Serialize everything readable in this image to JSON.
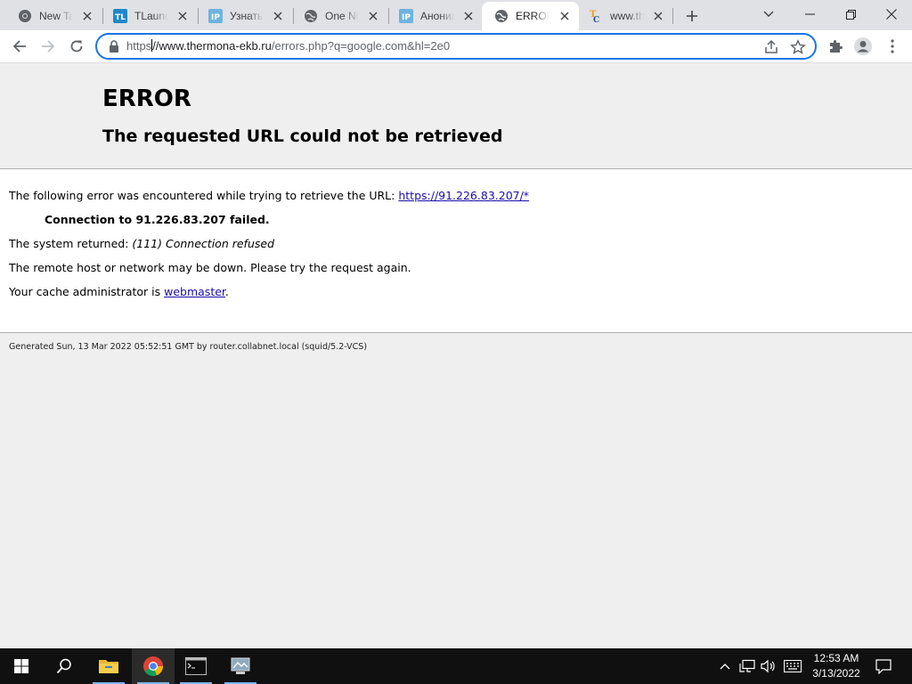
{
  "browser": {
    "tabs": [
      {
        "title": "New Tab",
        "icon": "chrome-icon",
        "active": false
      },
      {
        "title": "TLauncher",
        "icon": "tlauncher-icon",
        "active": false
      },
      {
        "title": "Узнать IP",
        "icon": "ip-icon",
        "active": false
      },
      {
        "title": "One Night",
        "icon": "globe-icon",
        "active": false
      },
      {
        "title": "Анонимайзер",
        "icon": "ip-icon",
        "active": false
      },
      {
        "title": "ERROR",
        "icon": "globe-icon",
        "active": true
      },
      {
        "title": "www.the",
        "icon": "thermona-icon",
        "active": false
      }
    ],
    "address_bar": {
      "scheme": "https",
      "cursor_after_scheme": true,
      "host": "//www.thermona-ekb.ru",
      "path": "/errors.php?q=google.com&hl=2e0"
    }
  },
  "page": {
    "heading": "ERROR",
    "subheading": "The requested URL could not be retrieved",
    "line1_text": "The following error was encountered while trying to retrieve the URL: ",
    "line1_link": "https://91.226.83.207/*",
    "error_detail": "Connection to 91.226.83.207 failed.",
    "system_returned_label": "The system returned: ",
    "system_returned_value": "(111) Connection refused",
    "remote_host_text": "The remote host or network may be down. Please try the request again.",
    "cache_admin_text": "Your cache administrator is ",
    "cache_admin_link": "webmaster",
    "cache_admin_suffix": ".",
    "footer": "Generated Sun, 13 Mar 2022 05:52:51 GMT by router.collabnet.local (squid/5.2-VCS)"
  },
  "taskbar": {
    "time": "12:53 AM",
    "date": "3/13/2022",
    "pinned": [
      "file-explorer-icon",
      "chrome-icon",
      "command-prompt-icon",
      "network-app-icon"
    ]
  },
  "colors": {
    "accent": "#1a73e8",
    "link": "#1a0dab",
    "tabstrip": "#dfe1e5",
    "taskbar": "#101010"
  }
}
